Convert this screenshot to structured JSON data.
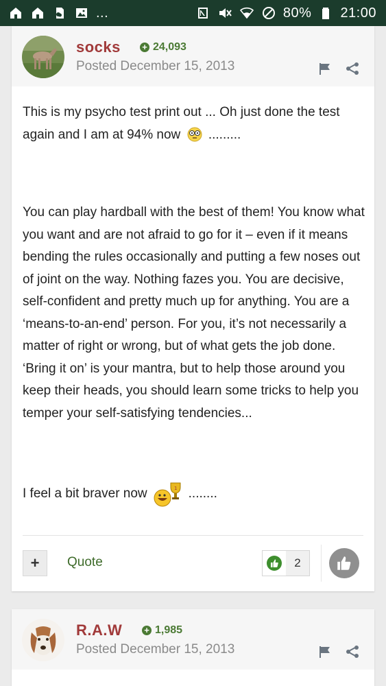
{
  "statusbar": {
    "left_icons": [
      "home-icon",
      "home-icon",
      "sim-icon",
      "image-icon"
    ],
    "overflow": "...",
    "right_icons": [
      "nfc-icon",
      "mute-icon",
      "wifi-icon",
      "do-not-disturb-icon"
    ],
    "battery": "80%",
    "time": "21:00"
  },
  "posts": [
    {
      "author": "socks",
      "reputation": "24,093",
      "posted": "Posted December 15, 2013",
      "body": {
        "p1": "This is my psycho test print out ... Oh just done the test again and I am at 94% now",
        "p1_tail": ".........",
        "p2": "You can play hardball with the best of them! You know what you want and are not afraid to go for it – even if it means bending the rules occasionally and putting a few noses out of joint on the way. Nothing fazes you. You are decisive, self-confident and pretty much up for anything. You are a ‘means-to-an-end’ person. For you, it’s not necessarily a matter of right or wrong, but of what gets the job done. ‘Bring it on’ is your mantra, but to help those around you keep their heads, you should learn some tricks to help you temper your self-satisfying tendencies...",
        "p3": "I feel a bit braver now",
        "p3_tail": "........"
      },
      "actions": {
        "plus": "+",
        "quote": "Quote",
        "reaction_count": "2"
      }
    },
    {
      "author": "R.A.W",
      "reputation": "1,985",
      "posted": "Posted December 15, 2013"
    }
  ],
  "colors": {
    "statusbar": "#1b3c2c",
    "author": "#a13a3a",
    "reputation": "#4b7a34",
    "quote": "#3e6b2a"
  }
}
